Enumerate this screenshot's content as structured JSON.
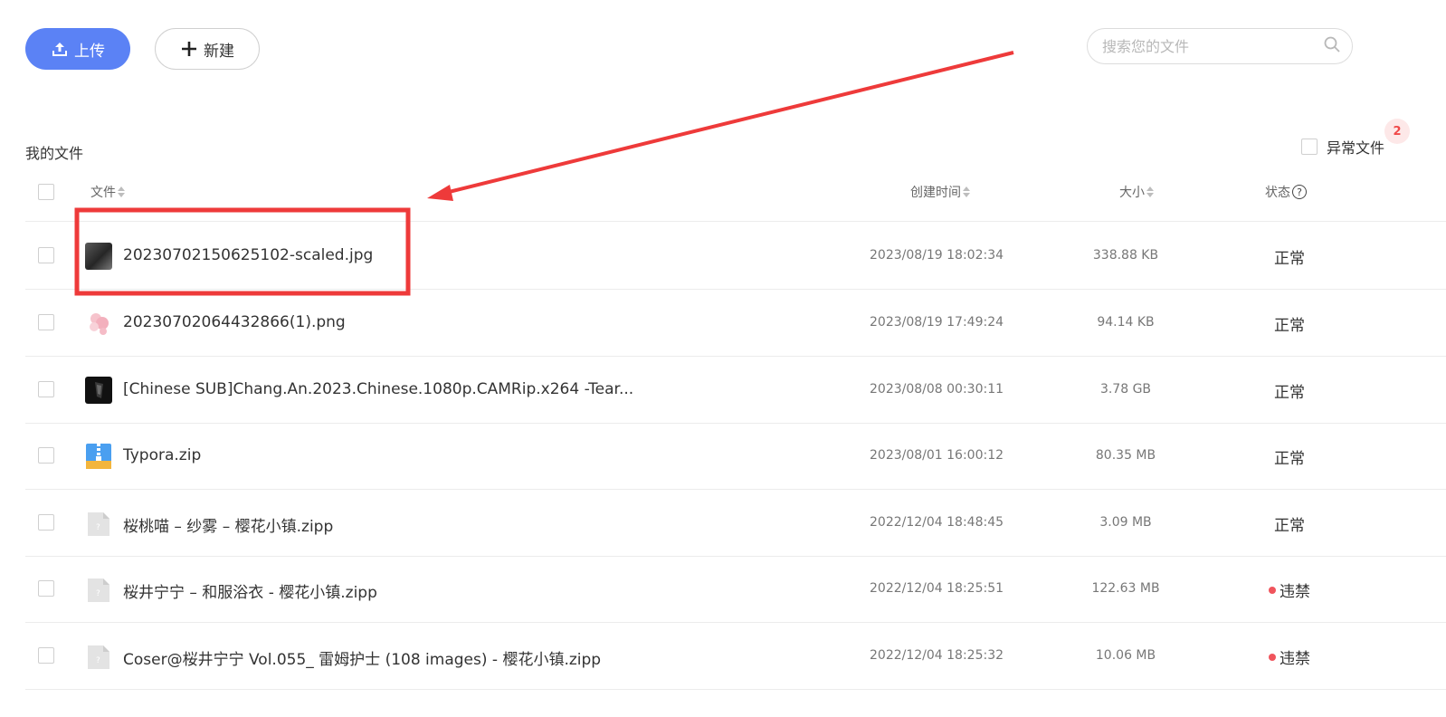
{
  "toolbar": {
    "upload_label": "上传",
    "new_label": "新建",
    "upload_icon": "upload-icon",
    "new_icon": "plus-icon"
  },
  "search": {
    "placeholder": "搜索您的文件",
    "icon": "search-icon"
  },
  "section_title": "我的文件",
  "abnormal_filter": {
    "label": "异常文件",
    "badge_count": "2"
  },
  "columns": {
    "file": "文件",
    "created": "创建时间",
    "size": "大小",
    "status": "状态",
    "status_help": "?"
  },
  "files": [
    {
      "name": "20230702150625102-scaled.jpg",
      "created": "2023/08/19 18:02:34",
      "size": "338.88 KB",
      "status": "正常",
      "type": "image-photo"
    },
    {
      "name": "20230702064432866(1).png",
      "created": "2023/08/19 17:49:24",
      "size": "94.14 KB",
      "status": "正常",
      "type": "image-png"
    },
    {
      "name": "[Chinese SUB]Chang.An.2023.Chinese.1080p.CAMRip.x264 -Tear...",
      "created": "2023/08/08 00:30:11",
      "size": "3.78 GB",
      "status": "正常",
      "type": "video"
    },
    {
      "name": "Typora.zip",
      "created": "2023/08/01 16:00:12",
      "size": "80.35 MB",
      "status": "正常",
      "type": "zip"
    },
    {
      "name": "桜桃喵 – 纱雾 – 樱花小镇.zipp",
      "created": "2022/12/04 18:48:45",
      "size": "3.09 MB",
      "status": "正常",
      "type": "unknown"
    },
    {
      "name": "桜井宁宁 – 和服浴衣 - 樱花小镇.zipp",
      "created": "2022/12/04 18:25:51",
      "size": "122.63 MB",
      "status": "违禁",
      "type": "unknown"
    },
    {
      "name": "Coser@桜井宁宁 Vol.055_ 雷姆护士 (108 images) - 樱花小镇.zipp",
      "created": "2022/12/04 18:25:32",
      "size": "10.06 MB",
      "status": "违禁",
      "type": "unknown"
    }
  ],
  "colors": {
    "accent": "#5b82f5",
    "danger": "#f0545c",
    "annotation": "#ee3a3a"
  }
}
